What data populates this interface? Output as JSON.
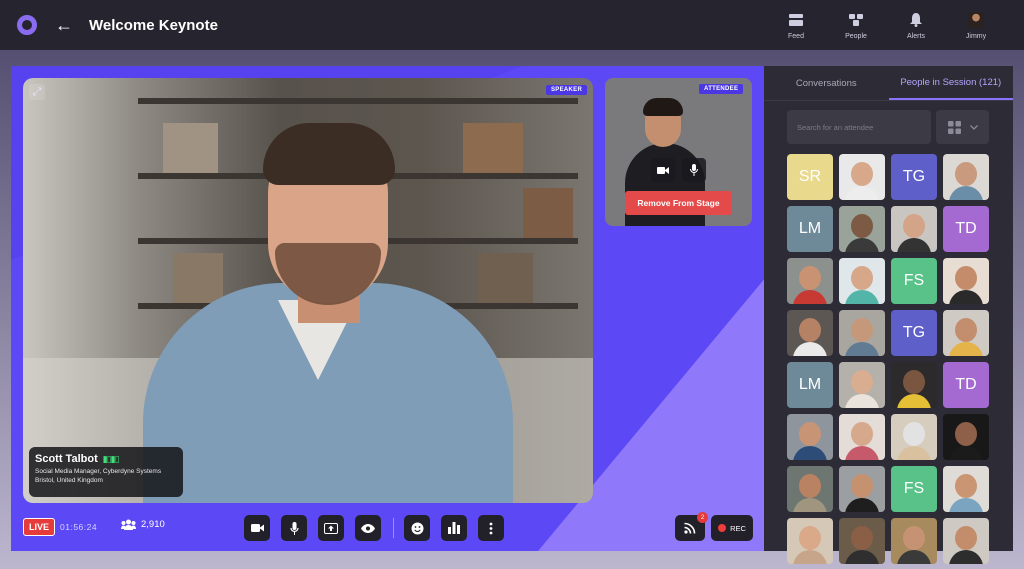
{
  "header": {
    "title": "Welcome Keynote",
    "nav": [
      {
        "label": "Feed",
        "icon": "feed-icon"
      },
      {
        "label": "People",
        "icon": "people-icon"
      },
      {
        "label": "Alerts",
        "icon": "bell-icon"
      },
      {
        "label": "Jimmy",
        "icon": "avatar"
      }
    ]
  },
  "stage": {
    "speaker_tag": "SPEAKER",
    "speaker_name": "Scott Talbot",
    "speaker_role": "Social Media Manager, Cyberdyne Systems",
    "speaker_location": "Bristol, United Kingdom",
    "attendee_tag": "ATTENDEE",
    "remove_label": "Remove From Stage"
  },
  "controls": {
    "live_label": "LIVE",
    "timer": "01:56:24",
    "viewers": "2,910",
    "rec_label": "REC",
    "feed_badge": "2"
  },
  "panel": {
    "tabs": [
      "Conversations",
      "People in Session (121)"
    ],
    "active_tab": 1,
    "search_placeholder": "Search for an attendee",
    "attendees": [
      {
        "initials": "SR",
        "color": "#e8d98d"
      },
      {
        "photo": true,
        "skin": "#d8a88a",
        "shirt": "#ededed",
        "bg": "#e9e9ea"
      },
      {
        "initials": "TG",
        "color": "#5f5fc9"
      },
      {
        "photo": true,
        "skin": "#c99a7d",
        "shirt": "#6b8ea8",
        "bg": "#dcd8d3"
      },
      {
        "initials": "LM",
        "color": "#6e8a99"
      },
      {
        "photo": true,
        "skin": "#7c5a44",
        "shirt": "#3a3a3a",
        "bg": "#9aa39a"
      },
      {
        "photo": true,
        "skin": "#d3a487",
        "shirt": "#333",
        "bg": "#c9c6c2"
      },
      {
        "initials": "TD",
        "color": "#a46ad1"
      },
      {
        "photo": true,
        "skin": "#c89273",
        "shirt": "#c73a33",
        "bg": "#8d918e"
      },
      {
        "photo": true,
        "skin": "#d6a788",
        "shirt": "#52b5a7",
        "bg": "#dfe7ea"
      },
      {
        "initials": "FS",
        "color": "#59c288"
      },
      {
        "photo": true,
        "skin": "#c58c6b",
        "shirt": "#2a2a2a",
        "bg": "#e7ddd2"
      },
      {
        "photo": true,
        "skin": "#b68266",
        "shirt": "#eaeaea",
        "bg": "#5c5752"
      },
      {
        "photo": true,
        "skin": "#c6987a",
        "shirt": "#607b92",
        "bg": "#a9a6a0"
      },
      {
        "initials": "TG",
        "color": "#5f5fc9"
      },
      {
        "photo": true,
        "skin": "#c38e6e",
        "shirt": "#e4b34a",
        "bg": "#cfcac4"
      },
      {
        "initials": "LM",
        "color": "#6e8a99"
      },
      {
        "photo": true,
        "skin": "#d9ad90",
        "shirt": "#e9e3dc",
        "bg": "#b4b0aa"
      },
      {
        "photo": true,
        "skin": "#7a5641",
        "shirt": "#e5c037",
        "bg": "#2c2a2a"
      },
      {
        "initials": "TD",
        "color": "#a46ad1"
      },
      {
        "photo": true,
        "skin": "#c89476",
        "shirt": "#2d4d78",
        "bg": "#8f959c"
      },
      {
        "photo": true,
        "skin": "#d6a88c",
        "shirt": "#c65a6a",
        "bg": "#e3dcd7"
      },
      {
        "photo": true,
        "skin": "#e2e2e2",
        "shirt": "#d9c1a0",
        "bg": "#d7cdbf"
      },
      {
        "photo": true,
        "skin": "#8e6049",
        "shirt": "#1b1b1b",
        "bg": "#181818"
      },
      {
        "photo": true,
        "skin": "#b98363",
        "shirt": "#a0957e",
        "bg": "#6d7670"
      },
      {
        "photo": true,
        "skin": "#c6916f",
        "shirt": "#1e1e1e",
        "bg": "#9b9fa2"
      },
      {
        "initials": "FS",
        "color": "#59c288"
      },
      {
        "photo": true,
        "skin": "#c99573",
        "shirt": "#7aa4c0",
        "bg": "#dfdcd7"
      },
      {
        "photo": true,
        "skin": "#d9a98a",
        "shirt": "#c7a58a",
        "bg": "#d5c8b7"
      },
      {
        "photo": true,
        "skin": "#8a5f46",
        "shirt": "#2f2f2f",
        "bg": "#6b5c49"
      },
      {
        "photo": true,
        "skin": "#c59374",
        "shirt": "#3a3a3a",
        "bg": "#a88a5f"
      },
      {
        "photo": true,
        "skin": "#c38d6b",
        "shirt": "#2d2d2d",
        "bg": "#cec9c2"
      }
    ]
  }
}
